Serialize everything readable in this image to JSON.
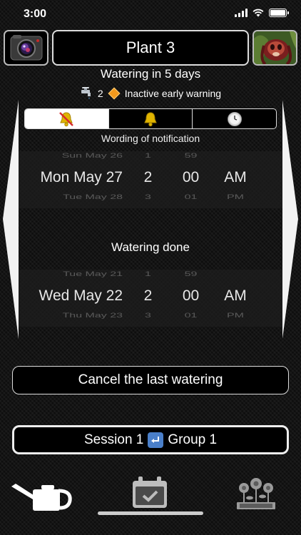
{
  "status": {
    "time": "3:00"
  },
  "header": {
    "title": "Plant 3"
  },
  "watering_in": "Watering in 5 days",
  "warning": {
    "count": "2",
    "label": "Inactive early warning"
  },
  "wording_label": "Wording of notification",
  "picker_notification": {
    "prev": {
      "date": "Sun May 26",
      "hour": "1",
      "minute": "59",
      "ampm": ""
    },
    "selected": {
      "date": "Mon May 27",
      "hour": "2",
      "minute": "00",
      "ampm": "AM"
    },
    "next": {
      "date": "Tue May 28",
      "hour": "3",
      "minute": "01",
      "ampm": "PM"
    }
  },
  "watering_done_label": "Watering done",
  "picker_done": {
    "prev": {
      "date": "Tue May 21",
      "hour": "1",
      "minute": "59",
      "ampm": ""
    },
    "selected": {
      "date": "Wed May 22",
      "hour": "2",
      "minute": "00",
      "ampm": "AM"
    },
    "next": {
      "date": "Thu May 23",
      "hour": "3",
      "minute": "01",
      "ampm": "PM"
    }
  },
  "cancel_button": "Cancel the last watering",
  "session": {
    "session_label": "Session 1",
    "group_label": "Group 1"
  },
  "icons": {
    "camera": "camera-icon",
    "plant_photo": "plant-photo",
    "faucet": "faucet-icon",
    "warning": "orange-diamond-icon",
    "bell_off": "bell-off-icon",
    "bell": "bell-icon",
    "clock": "clock-icon",
    "watering_can": "watering-can-icon",
    "calendar": "calendar-check-icon",
    "garden": "garden-icon"
  },
  "colors": {
    "accent_orange": "#f39a1d",
    "swap_blue": "#4a7fc9",
    "bell_red": "#d62b2b",
    "bell_gold": "#e0b400"
  }
}
